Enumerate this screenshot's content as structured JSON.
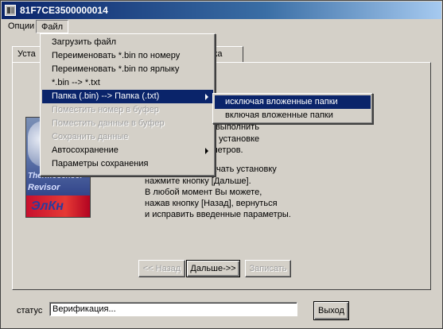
{
  "window": {
    "title": "81F7CE3500000014"
  },
  "menubar": {
    "options": "Опции",
    "file": "Файл"
  },
  "tabs": {
    "left": "Уста",
    "right": "жка"
  },
  "info": [
    "ы выполнить",
    "по установке",
    "аметров.",
    "начать установку",
    "нажмите кнопку [Дальше].",
    "В любой момент Вы можете,",
    "нажав кнопку [Назад], вернуться",
    "и исправить введенные параметры."
  ],
  "logo": {
    "line1": "Thermosensor",
    "line2": "Revisor",
    "line3": "ЭлКн"
  },
  "buttons": {
    "back": "<< Назад",
    "next": "Дальше->>",
    "write": "Записать",
    "exit": "Выход"
  },
  "status": {
    "label": "статус",
    "value": "Верификация..."
  },
  "file_menu": {
    "items": [
      "Загрузить файл",
      "Переименовать *.bin по номеру",
      "Переименовать *.bin по ярлыку",
      "*.bin --> *.txt",
      "Папка (.bin) --> Папка (.txt)",
      "Поместить номер в буфер",
      "Поместить данные в буфер",
      "Сохранить данные",
      "Автосохранение",
      "Параметры сохранения"
    ]
  },
  "submenu": {
    "items": [
      "исключая вложенные папки",
      "включая вложенные папки"
    ]
  }
}
